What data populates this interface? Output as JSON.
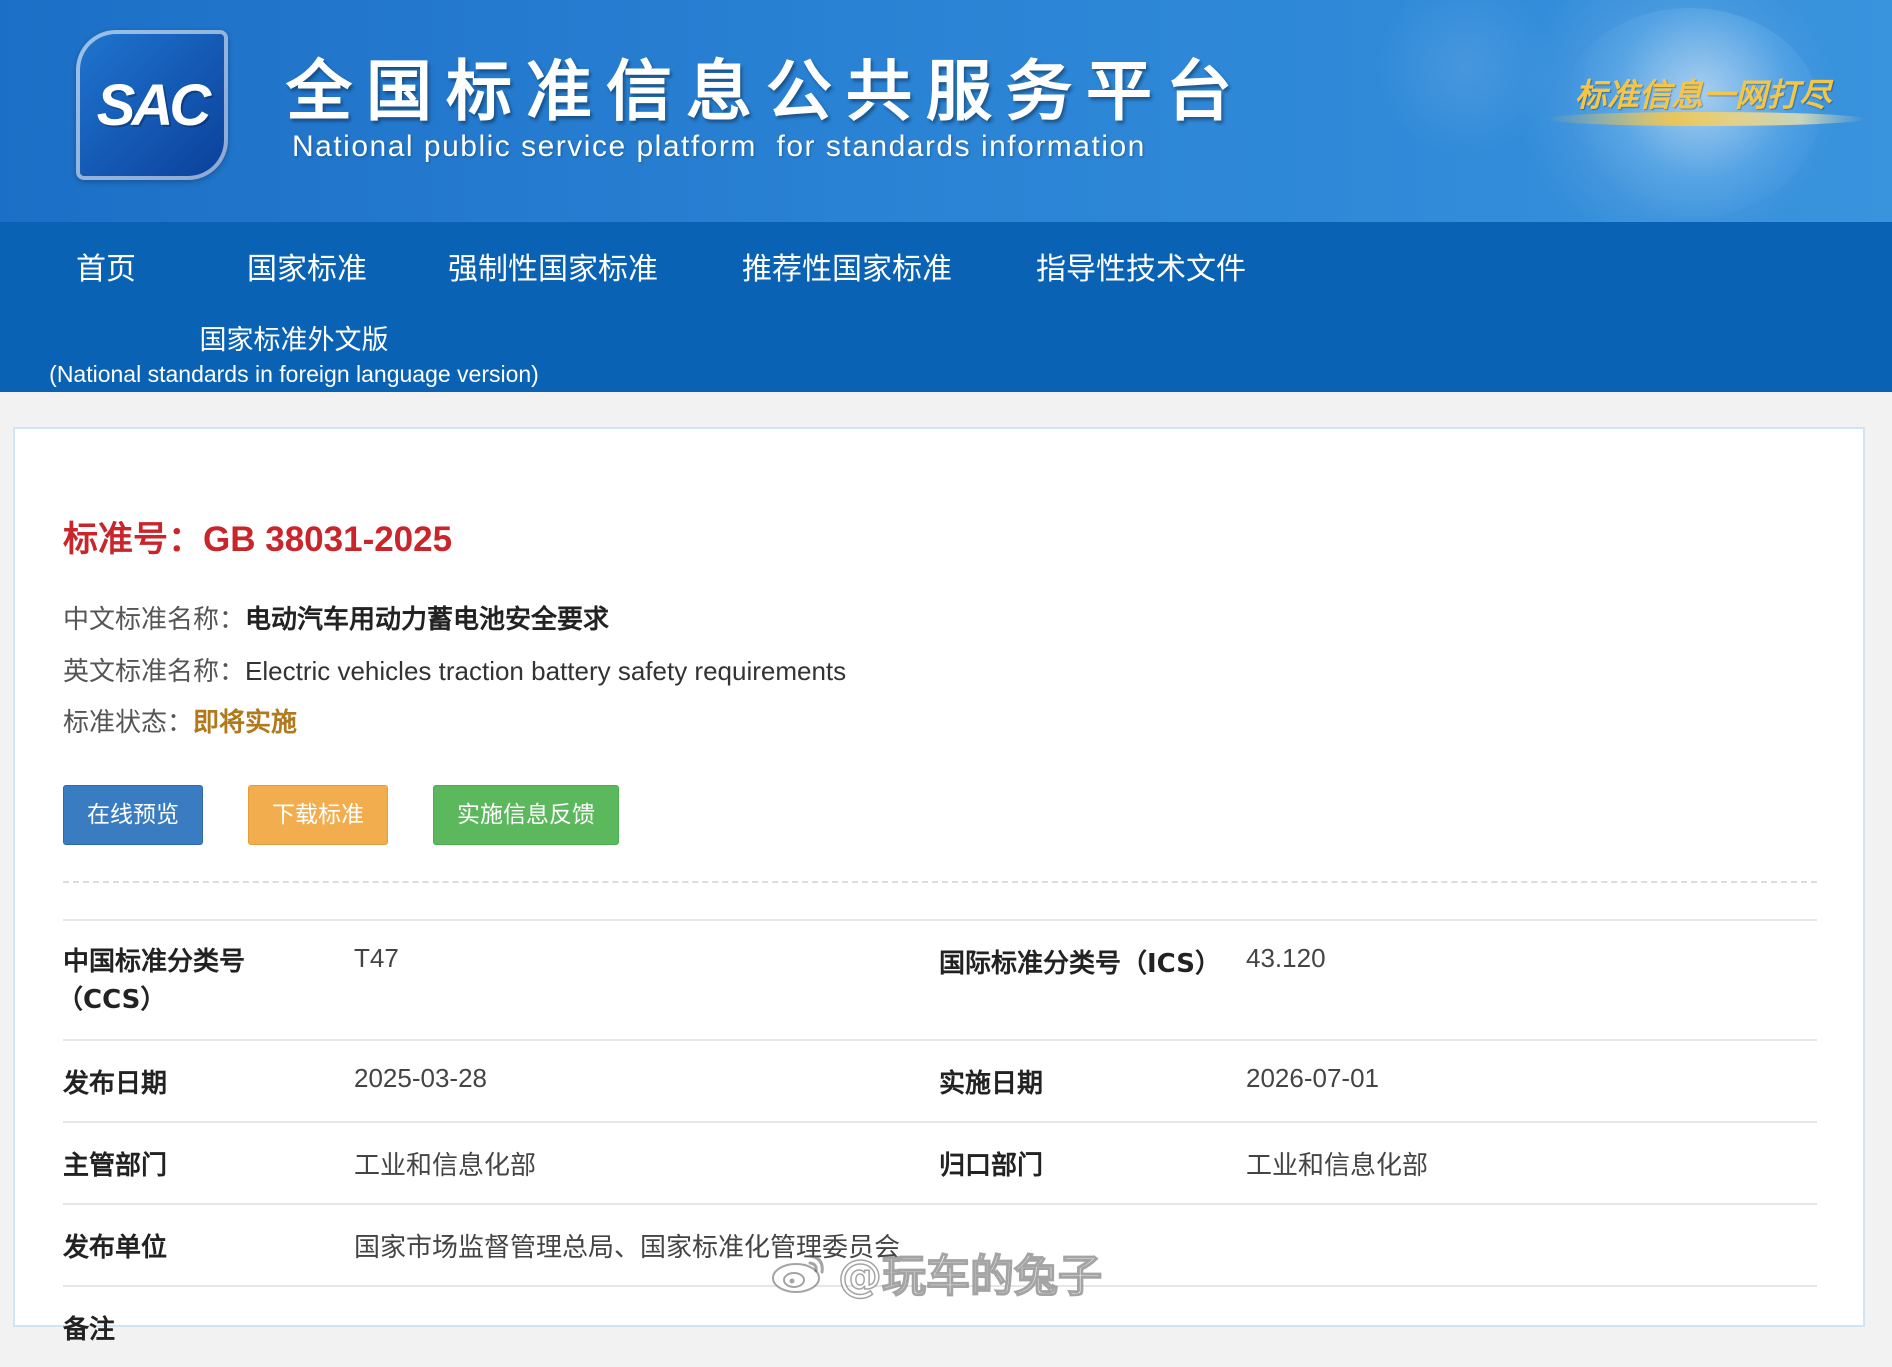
{
  "header": {
    "logo_text": "SAC",
    "title": "全国标准信息公共服务平台",
    "subtitle": "National public service platform  for standards information",
    "slogan": "标准信息一网打尽"
  },
  "nav": {
    "items": [
      {
        "label": "首页"
      },
      {
        "label": "国家标准"
      },
      {
        "label": "强制性国家标准"
      },
      {
        "label": "推荐性国家标准"
      },
      {
        "label": "指导性技术文件"
      }
    ],
    "foreign_cn": "国家标准外文版",
    "foreign_en": "(National standards in foreign language version)"
  },
  "standard": {
    "number_label": "标准号：",
    "number": "GB 38031-2025",
    "cn_name_label": "中文标准名称：",
    "cn_name": "电动汽车用动力蓄电池安全要求",
    "en_name_label": "英文标准名称：",
    "en_name": "Electric vehicles traction battery safety requirements",
    "status_label": "标准状态：",
    "status": "即将实施",
    "status_color": "#b07a1c"
  },
  "buttons": {
    "preview": "在线预览",
    "download": "下载标准",
    "feedback": "实施信息反馈"
  },
  "details": {
    "ccs_label_line1": "中国标准分类号",
    "ccs_label_line2": "（CCS）",
    "ccs": "T47",
    "ics_label": "国际标准分类号（ICS）",
    "ics": "43.120",
    "publish_date_label": "发布日期",
    "publish_date": "2025-03-28",
    "impl_date_label": "实施日期",
    "impl_date": "2026-07-01",
    "dept_label": "主管部门",
    "dept": "工业和信息化部",
    "centralized_label": "归口部门",
    "centralized": "工业和信息化部",
    "issuer_label": "发布单位",
    "issuer": "国家市场监督管理总局、国家标准化管理委员会",
    "remark_label": "备注"
  },
  "watermark": {
    "text": "@玩车的兔子"
  },
  "colors": {
    "header_blue": "#1c6fc6",
    "nav_blue": "#0a62b5",
    "std_red": "#c9252b",
    "btn_blue": "#3a7cc2",
    "btn_orange": "#f2ad4e",
    "btn_green": "#5cb85c"
  }
}
